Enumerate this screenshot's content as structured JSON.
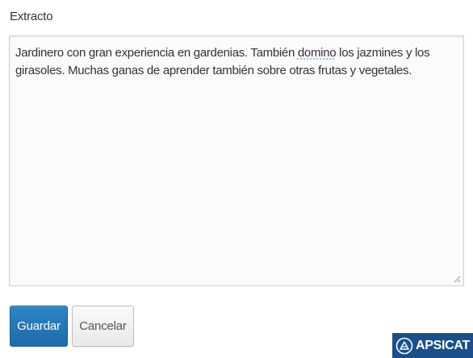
{
  "form": {
    "label": "Extracto",
    "textarea": {
      "text_before": "Jardinero con gran experiencia en gardenias. También ",
      "text_flagged": "domino",
      "text_after": " los jazmines y los girasoles. Muchas ganas de aprender también sobre otras frutas y vegetales."
    },
    "save_label": "Guardar",
    "cancel_label": "Cancelar"
  },
  "watermark": {
    "text": "APSICAT",
    "color": "#1b4f8c"
  },
  "colors": {
    "primary_button": "#2470b3",
    "text": "#333333",
    "border": "#cfcfcf"
  },
  "icons": [
    "resize-handle-icon",
    "apsicat-logo-icon"
  ]
}
